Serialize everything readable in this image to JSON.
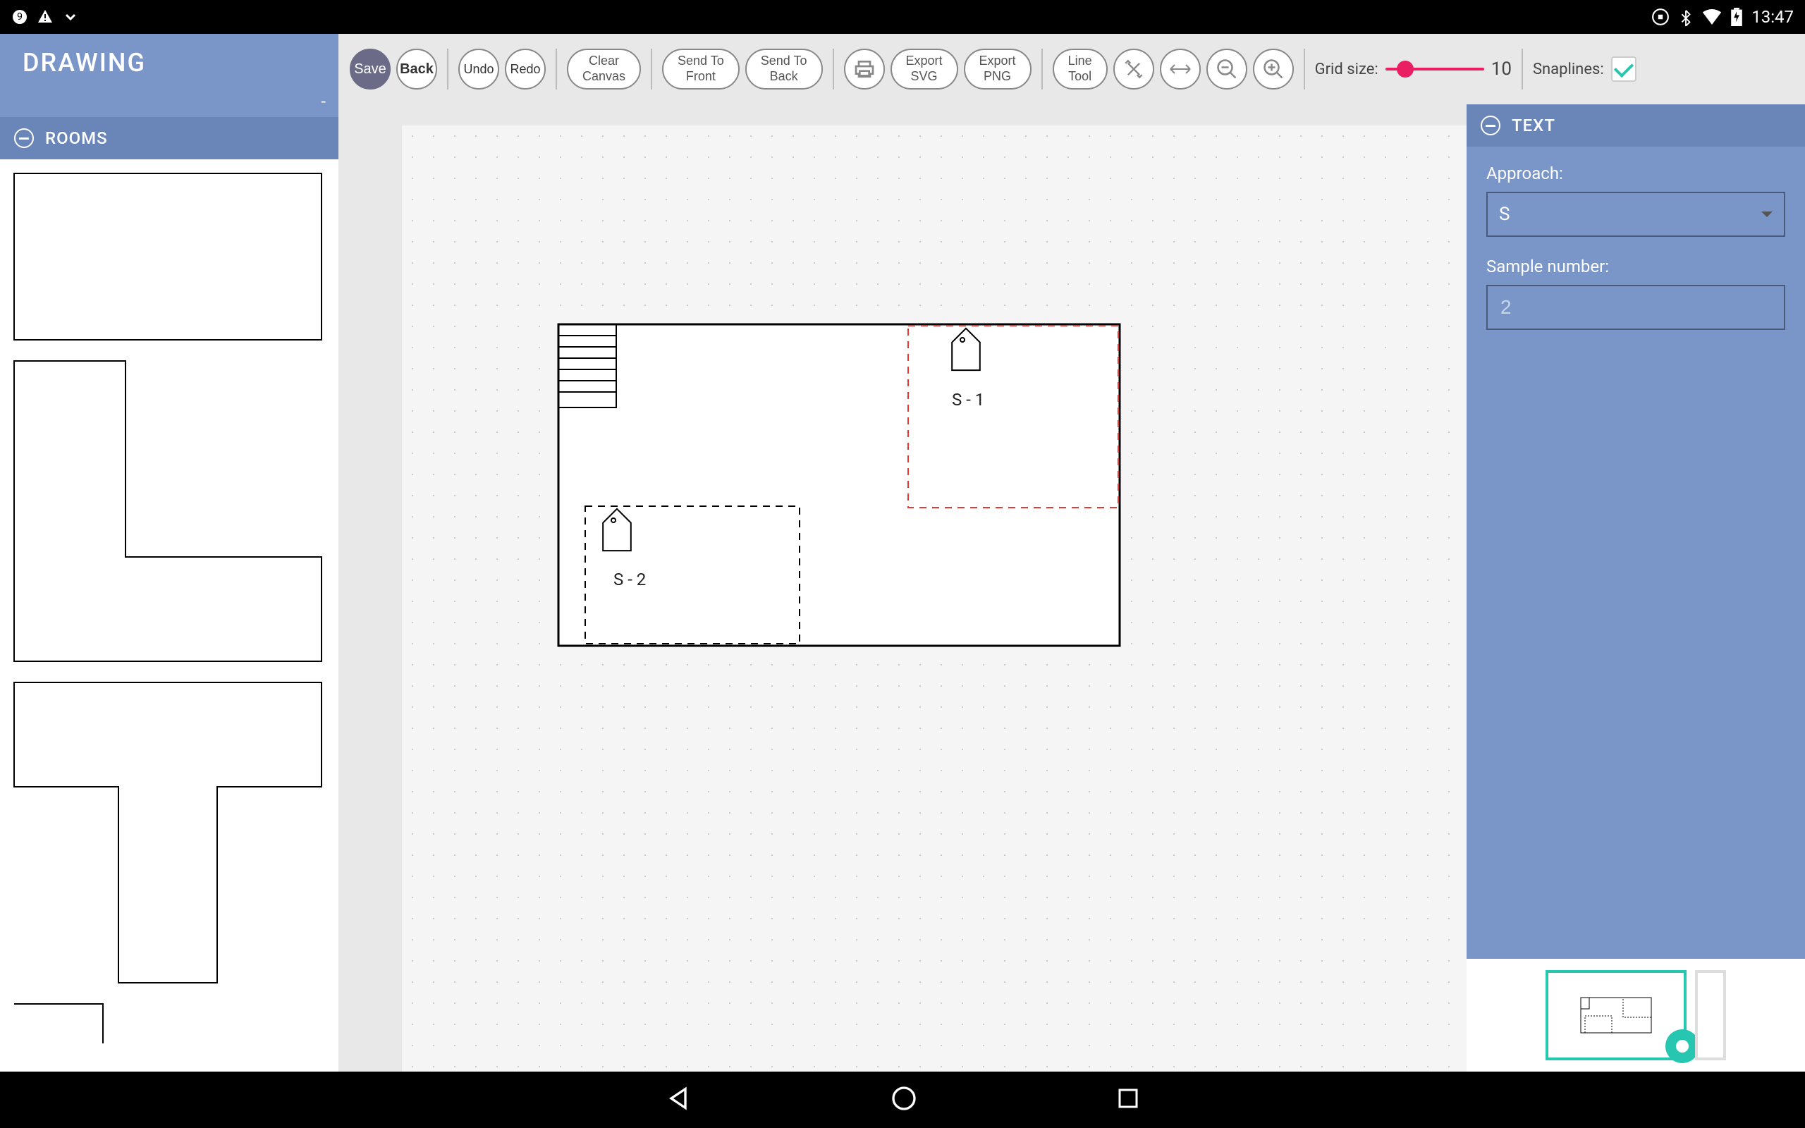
{
  "status_bar": {
    "time": "13:47"
  },
  "sidebar": {
    "title": "DRAWING",
    "subtitle": "-",
    "rooms_label": "ROOMS"
  },
  "toolbar": {
    "save": "Save",
    "back": "Back",
    "undo": "Undo",
    "redo": "Redo",
    "clear_canvas_1": "Clear",
    "clear_canvas_2": "Canvas",
    "send_front_1": "Send To",
    "send_front_2": "Front",
    "send_back_1": "Send To",
    "send_back_2": "Back",
    "export_svg_1": "Export",
    "export_svg_2": "SVG",
    "export_png_1": "Export",
    "export_png_2": "PNG",
    "line_tool_1": "Line",
    "line_tool_2": "Tool",
    "grid_size_label": "Grid size:",
    "grid_size_value": "10",
    "snaplines_label": "Snaplines:"
  },
  "canvas": {
    "tag1": "S - 1",
    "tag2": "S - 2"
  },
  "right_panel": {
    "title": "TEXT",
    "approach_label": "Approach:",
    "approach_value": "S",
    "sample_label": "Sample number:",
    "sample_value": "2"
  }
}
